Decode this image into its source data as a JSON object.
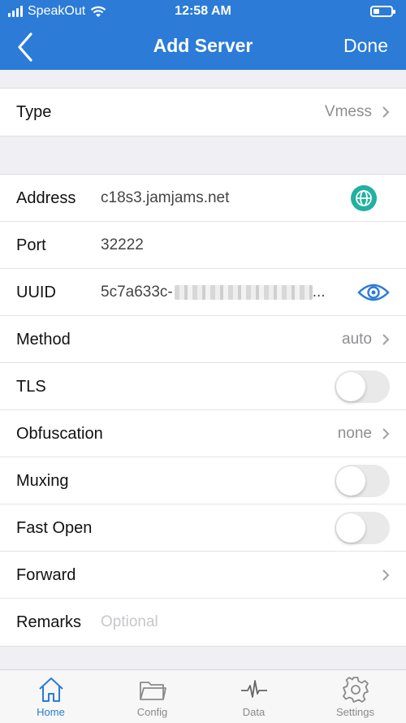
{
  "status_bar": {
    "carrier": "SpeakOut",
    "time": "12:58 AM"
  },
  "nav": {
    "title": "Add Server",
    "done_label": "Done"
  },
  "type_row": {
    "label": "Type",
    "value": "Vmess"
  },
  "server": {
    "address": {
      "label": "Address",
      "value": "c18s3.jamjams.net"
    },
    "port": {
      "label": "Port",
      "value": "32222"
    },
    "uuid": {
      "label": "UUID",
      "value_visible": "5c7a633c-",
      "value_suffix": "..."
    },
    "method": {
      "label": "Method",
      "value": "auto"
    },
    "tls": {
      "label": "TLS",
      "on": false
    },
    "obfuscation": {
      "label": "Obfuscation",
      "value": "none"
    },
    "muxing": {
      "label": "Muxing",
      "on": false
    },
    "fast_open": {
      "label": "Fast Open",
      "on": false
    },
    "forward": {
      "label": "Forward"
    },
    "remarks": {
      "label": "Remarks",
      "placeholder": "Optional"
    }
  },
  "tabs": [
    {
      "label": "Home",
      "icon": "home-icon",
      "active": true
    },
    {
      "label": "Config",
      "icon": "folder-icon",
      "active": false
    },
    {
      "label": "Data",
      "icon": "pulse-icon",
      "active": false
    },
    {
      "label": "Settings",
      "icon": "gear-icon",
      "active": false
    }
  ],
  "colors": {
    "accent": "#2b7bd7",
    "globe": "#21b1a0",
    "toggle_off": "#e9e9ea",
    "background": "#efeff4"
  }
}
